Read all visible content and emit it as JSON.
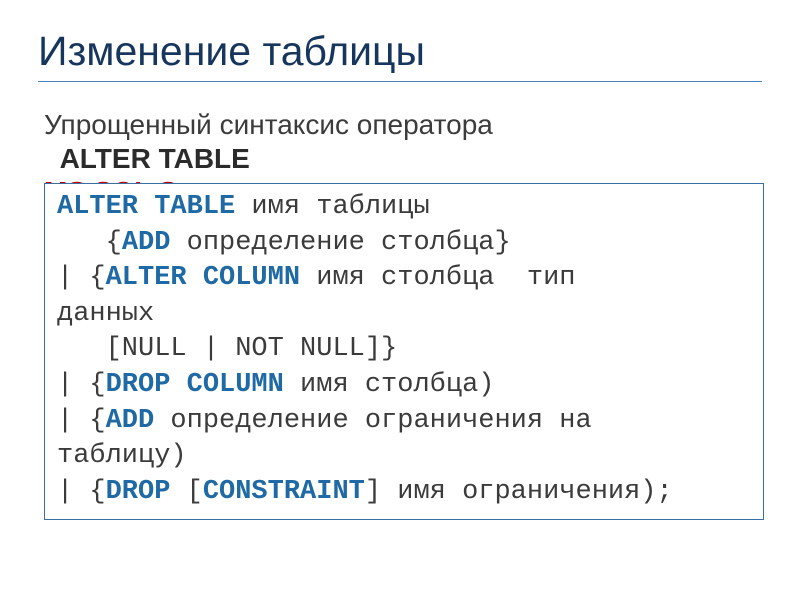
{
  "title": "Изменение таблицы",
  "intro": {
    "line1": "Упрощенный синтаксис оператора",
    "keyword": "ALTER TABLE"
  },
  "hidden_label": "MS SQL Server:",
  "code": {
    "l1a": "ALTER TABLE",
    "l1b": " имя таблицы",
    "l2a": "   {",
    "l2b": "ADD",
    "l2c": " определение столбца}",
    "l3a": "| {",
    "l3b": "ALTER COLUMN",
    "l3c": " имя столбца  тип",
    "l4": "данных",
    "l5": "   [NULL | NOT NULL]}",
    "l6a": "| {",
    "l6b": "DROP COLUMN",
    "l6c": " имя столбца)",
    "l7a": "| {",
    "l7b": "ADD",
    "l7c": " определение ограничения на",
    "l8": "таблицу)",
    "l9a": "| {",
    "l9b": "DROP",
    "l9c": " [",
    "l9d": "CONSTRAINT",
    "l9e": "] имя ограничения);"
  }
}
